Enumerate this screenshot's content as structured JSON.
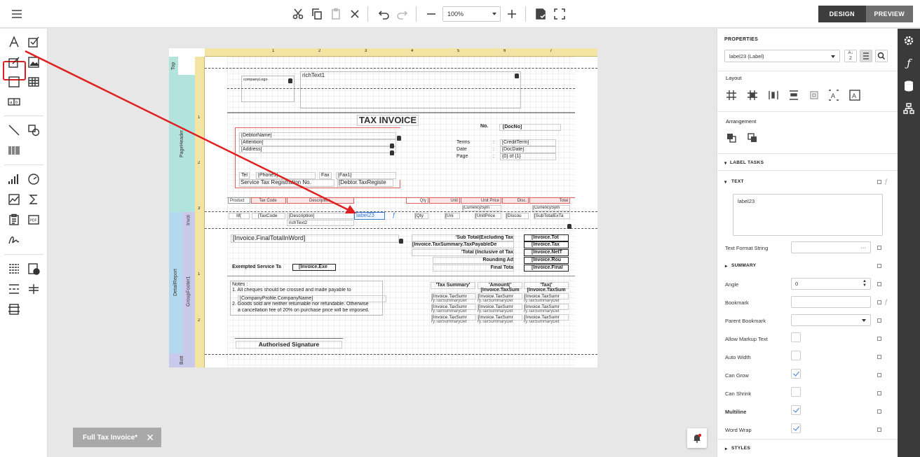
{
  "toolbar": {
    "zoom": "100%",
    "design_label": "DESIGN",
    "preview_label": "PREVIEW"
  },
  "document_tab": {
    "label": "Full Tax Invoice*",
    "close": "✕"
  },
  "report": {
    "bands": {
      "top": "Top",
      "page_header": "PageHeader",
      "detail_report": "DetailReport",
      "invoice": "Invoi",
      "group_footer": "GroupFooter1",
      "bottom": "Bott"
    },
    "ruler_top": [
      "1",
      "2",
      "3",
      "4",
      "5",
      "6",
      "7"
    ],
    "ruler_left": [
      "1",
      "2",
      "3",
      "1",
      "2"
    ],
    "company_logo": "companyLogo",
    "rich_text1": "richText1",
    "title": "TAX INVOICE",
    "no_label": "No.",
    "doc_no": "[DocNo]",
    "debtor_name": "[DebtorName]",
    "attention": "[Attention]",
    "address": "[Address]",
    "terms_label": "Terms",
    "date_label": "Date",
    "page_label": "Page",
    "colon": ":",
    "credit_term": "[CreditTerm]",
    "doc_date": "[DocDate]",
    "page_of": "{0} of {1}",
    "tel_label": "Tel",
    "phone1": "[Phone1]",
    "fax_label": "Fax",
    "fax1": "[Fax1]",
    "service_tax": "Service Tax Registration No.",
    "debtor_tax": "[Debtor.TaxRegiste",
    "headers": {
      "product": "Product",
      "tax_code": "Tax Code",
      "description": "Description",
      "qty": "Qty",
      "unit": "Unit",
      "unit_price": "Unit Price",
      "disc": "Disc.",
      "total": "Total"
    },
    "currency_sym1": "[CurrencySym",
    "currency_sym2": "[CurrencySym",
    "detail": {
      "iif": "Iif(",
      "tax_code": "[TaxCode",
      "description": "[Description]",
      "label23": "label23",
      "qty": "[Qty",
      "unit": "[Uni",
      "unit_price": "[UnitPrice",
      "discount": "[Discou",
      "sub_total": "[SubTotalExTa",
      "rich_text2": "richText2"
    },
    "final_total_word": "[Invoice.FinalTotalInWord]",
    "sub_total_label": "'Sub Total(Excluding Tax",
    "sub_total_val": "[Invoice.Tot",
    "tax_summary_label": "[Invoice.TaxSummary.TaxPayableDe",
    "tax_summary_val": "[Invoice.Tax",
    "total_incl_label": "'Total (Inclusive of Tax",
    "total_incl_val": "[Invoice.NetT",
    "rounding_label": "Rounding Ad",
    "rounding_val": "[Invoice.Rou",
    "exempted_label": "Exempted Service Ta",
    "exempted_val": "[Invoice.Exe",
    "final_total_label": "Final Tota",
    "final_total_val": "[Invoice.Final",
    "notes_title": "Notes :",
    "note1": "1. All cheques should be crossed and made payable to",
    "company_name": "[CompanyProfile.CompanyName]",
    "note2a": "2. Goods sold are neither returnable nor refundable. Otherwise",
    "note2b": "a cancellation fee of 20% on purchase price will be imposed.",
    "tax_summary_title": "'Tax Summary'",
    "amount_title": "'Amount('",
    "tax_title": "'Tax('",
    "tax_amount_head": "[Invoice.TaxSum",
    "tax_tax_head": "[Invoice.TaxSum",
    "tax_rows": [
      [
        "[Invoice.TaxSumr",
        "[Invoice.TaxSumr",
        "[Invoice.TaxSumr"
      ],
      [
        "[Invoice.TaxSumr",
        "[Invoice.TaxSumr",
        "[Invoice.TaxSumr"
      ],
      [
        "[Invoice.TaxSumr",
        "[Invoice.TaxSumr",
        "[Invoice.TaxSumr"
      ]
    ],
    "tax_row_sub": "ry.TaxSummaryDet",
    "authorised": "Authorised Signature"
  },
  "properties": {
    "title": "PROPERTIES",
    "selected": "label23 (Label)",
    "layout_title": "Layout",
    "arrangement_title": "Arrangement",
    "label_tasks": "LABEL TASKS",
    "text_section": "TEXT",
    "text_value": "label23",
    "text_format": "Text Format String",
    "text_format_dots": "···",
    "summary": "SUMMARY",
    "angle": "Angle",
    "angle_value": "0",
    "bookmark": "Bookmark",
    "parent_bookmark": "Parent Bookmark",
    "allow_markup": "Allow Markup Text",
    "auto_width": "Auto Width",
    "can_grow": "Can Grow",
    "can_shrink": "Can Shrink",
    "multiline": "Multiline",
    "word_wrap": "Word Wrap",
    "styles": "STYLES"
  },
  "colors": {
    "highlight": "#e02020",
    "band_cyan": "#b2e3dc",
    "band_blue": "#b3d9ef",
    "band_lavender": "#c9c9ec",
    "ruler": "#f4e4a3",
    "header_cell": "#fde6e6",
    "accent": "#3a7bd5"
  },
  "icons": {
    "menu": "menu-icon",
    "cut": "cut-icon",
    "copy": "copy-icon",
    "paste": "paste-icon",
    "delete": "delete-icon",
    "undo": "undo-icon",
    "redo": "redo-icon",
    "zoom_out": "zoom-out-icon",
    "zoom_in": "zoom-in-icon",
    "validate": "script-validate-icon",
    "fullscreen": "fullscreen-icon",
    "settings": "gear-icon",
    "function": "function-icon",
    "database": "database-icon",
    "structure": "report-explorer-icon"
  }
}
